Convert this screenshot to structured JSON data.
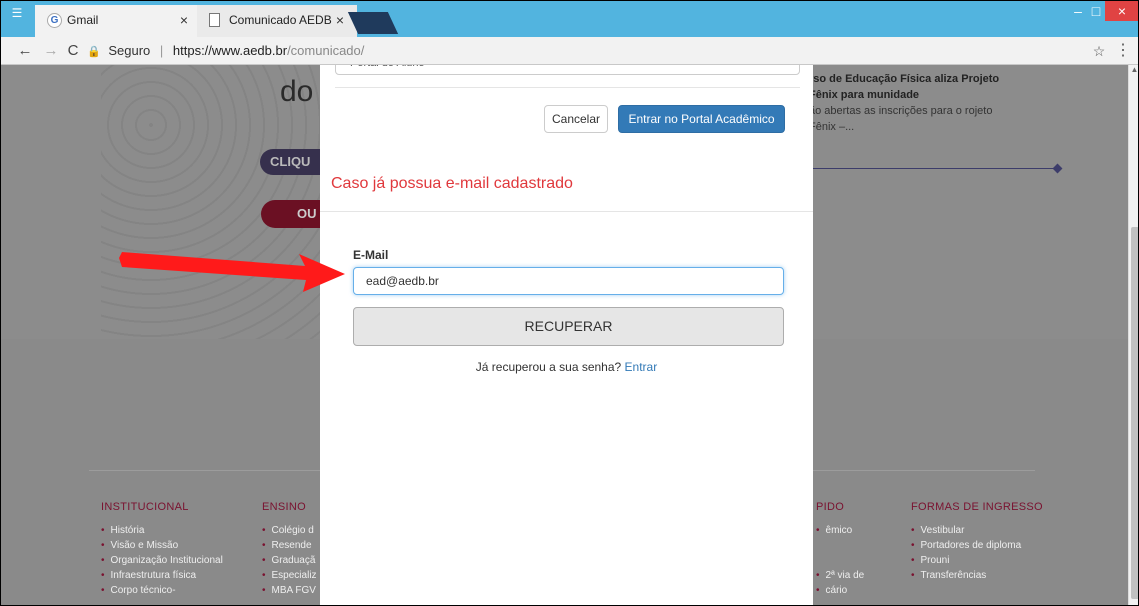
{
  "browser": {
    "tabs": [
      {
        "label": "Gmail",
        "active": true
      },
      {
        "label": "Comunicado AEDB",
        "active": false
      }
    ],
    "close_glyph": "×",
    "omnibox": {
      "secure_label": "Seguro",
      "separator": "|",
      "url_host": "https://www.aedb.br",
      "url_path": "/comunicado/"
    }
  },
  "hero": {
    "do_text": "do",
    "clique_text": "CLIQU",
    "ou_text": "OU"
  },
  "news": {
    "title": "rso de Educação Física aliza Projeto Fênix para munidade",
    "description": "ão abertas as inscrições para o rojeto Fênix –..."
  },
  "modal": {
    "previous_field_value": "Portal do Aluno",
    "cancel_label": "Cancelar",
    "portal_label": "Entrar no Portal Acadêmico",
    "section_title": "Caso já possua e-mail cadastrado",
    "email_label": "E-Mail",
    "email_value": "ead@aedb.br",
    "recover_label": "RECUPERAR",
    "recovered_question": "Já recuperou a sua senha?",
    "login_link": "Entrar"
  },
  "footer": {
    "institucional": {
      "heading": "INSTITUCIONAL",
      "items": [
        "História",
        "Visão e Missão",
        "Organização Institucional",
        "Infraestrutura física",
        "Corpo técnico-"
      ]
    },
    "ensino": {
      "heading": "ENSINO",
      "items": [
        "Colégio d",
        "Resende",
        "Graduaçã",
        "Especializ",
        "MBA FGV"
      ]
    },
    "acesso": {
      "heading": "PIDO",
      "items": [
        "êmico",
        "",
        "",
        "2ª via de",
        "cário"
      ]
    },
    "ingresso": {
      "heading": "FORMAS DE INGRESSO",
      "items": [
        "Vestibular",
        "Portadores de diploma",
        "Prouni",
        "Transferências"
      ]
    }
  },
  "colors": {
    "titlebar": "#52b4df",
    "primary_button": "#337ab7",
    "section_title": "#e0383c",
    "annotation_arrow": "#ff1a1a",
    "footer_heading": "#7a1230"
  }
}
